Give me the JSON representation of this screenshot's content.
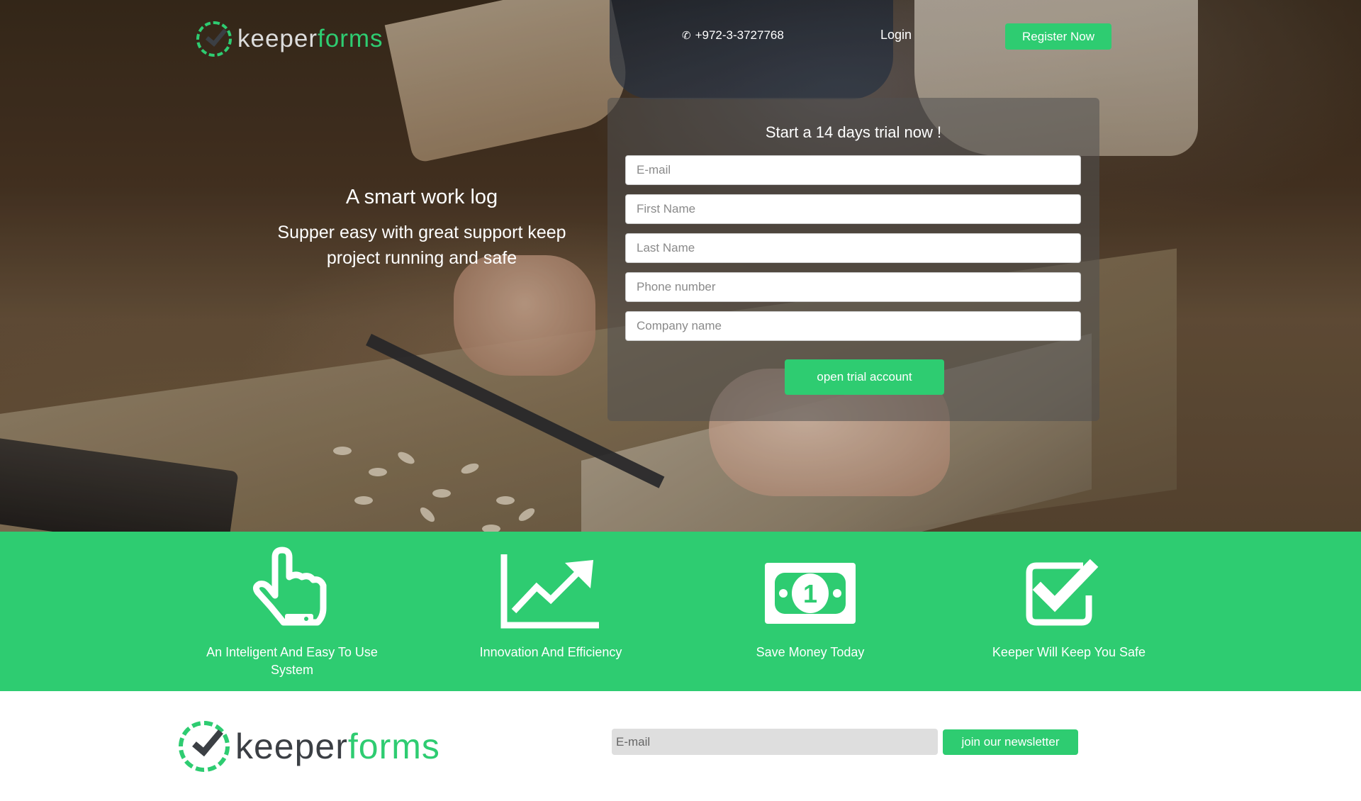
{
  "header": {
    "logo_part1": "keeper",
    "logo_part2": "forms",
    "phone": "+972-3-3727768",
    "login_label": "Login",
    "register_label": "Register Now"
  },
  "hero": {
    "title": "A smart work log",
    "subtitle": "Supper easy with great support keep project running and safe"
  },
  "trial_form": {
    "title": "Start a 14 days trial now !",
    "email_placeholder": "E-mail",
    "first_name_placeholder": "First Name",
    "last_name_placeholder": "Last Name",
    "phone_placeholder": "Phone number",
    "company_placeholder": "Company name",
    "submit_label": "open trial account"
  },
  "features": [
    {
      "icon": "pointer-hand-icon",
      "label": "An Inteligent And Easy To Use System"
    },
    {
      "icon": "trending-up-chart-icon",
      "label": "Innovation And Efficiency"
    },
    {
      "icon": "dollar-bill-icon",
      "label": "Save Money Today"
    },
    {
      "icon": "checkbox-icon",
      "label": "Keeper Will Keep You Safe"
    }
  ],
  "footer": {
    "logo_part1": "keeper",
    "logo_part2": "forms",
    "newsletter_placeholder": "E-mail",
    "newsletter_button": "join our newsletter"
  },
  "colors": {
    "accent": "#2ecc71",
    "logo_dark": "#3b3f44"
  }
}
